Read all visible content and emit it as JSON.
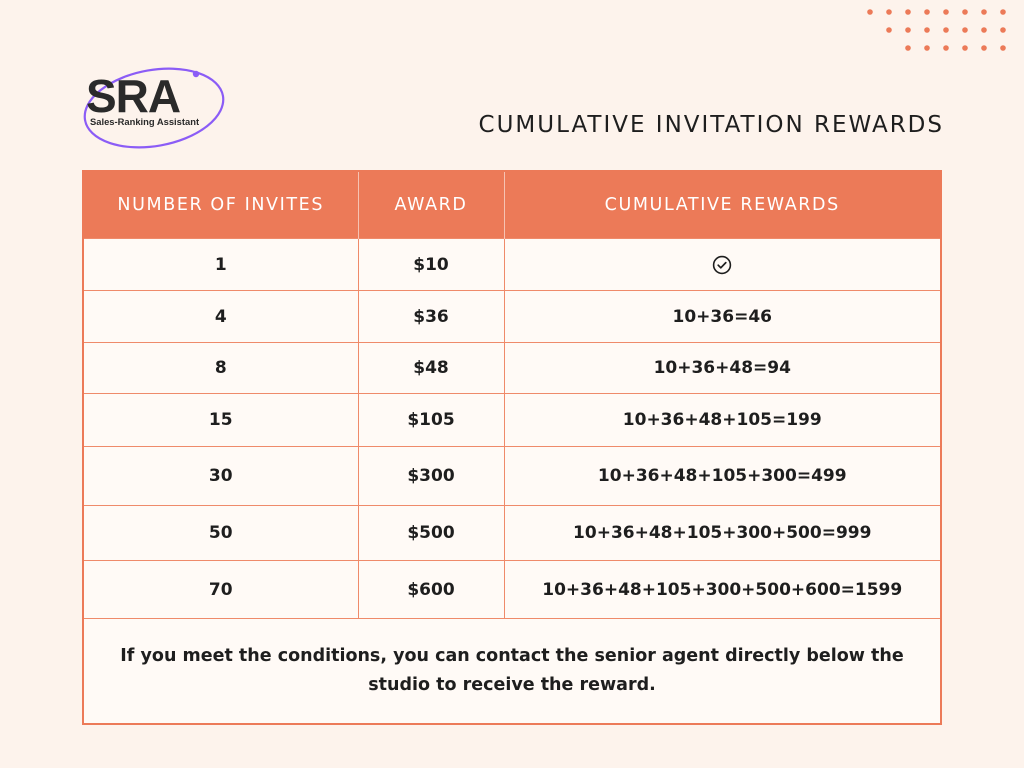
{
  "logo": {
    "main": "SRA",
    "tagline": "Sales-Ranking Assistant"
  },
  "title": "CUMULATIVE INVITATION REWARDS",
  "table": {
    "headers": [
      "NUMBER OF INVITES",
      "AWARD",
      "CUMULATIVE REWARDS"
    ],
    "rows": [
      {
        "invites": "1",
        "award": "$10",
        "cumulative": "",
        "cumulative_icon": "check-circle-icon"
      },
      {
        "invites": "4",
        "award": "$36",
        "cumulative": "10+36=46"
      },
      {
        "invites": "8",
        "award": "$48",
        "cumulative": "10+36+48=94"
      },
      {
        "invites": "15",
        "award": "$105",
        "cumulative": "10+36+48+105=199"
      },
      {
        "invites": "30",
        "award": "$300",
        "cumulative": "10+36+48+105+300=499"
      },
      {
        "invites": "50",
        "award": "$500",
        "cumulative": "10+36+48+105+300+500=999"
      },
      {
        "invites": "70",
        "award": "$600",
        "cumulative": "10+36+48+105+300+500+600=1599"
      }
    ],
    "note": "If you meet the conditions, you can contact the senior agent directly below the studio to receive the reward."
  },
  "colors": {
    "accent": "#ec7a58",
    "background": "#fdf3ec",
    "logo_ring": "#8b5cf6",
    "dots": "#ec7a58"
  }
}
